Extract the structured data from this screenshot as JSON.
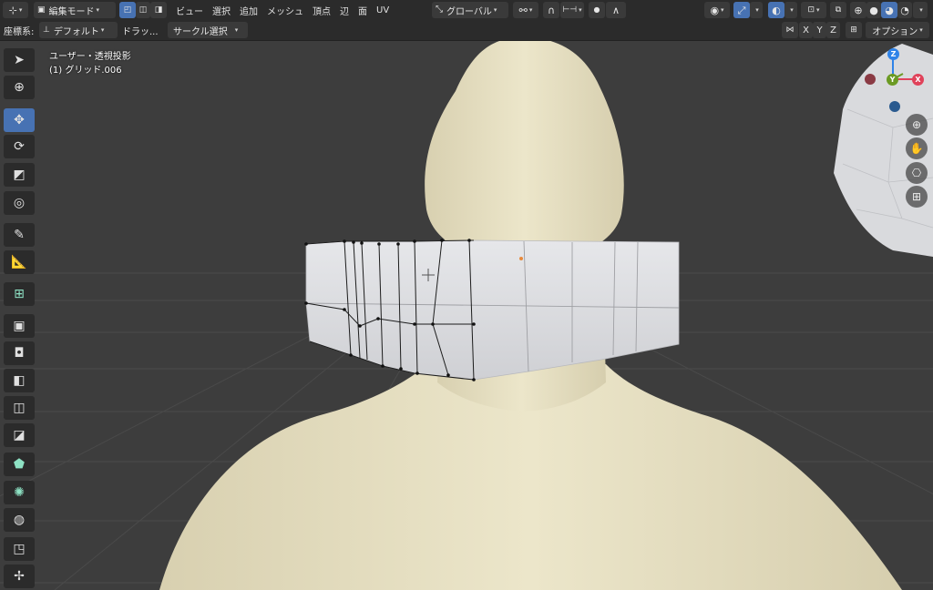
{
  "header": {
    "editor_type_icon": "editor-type-icon",
    "mode": "編集モード",
    "menus": [
      "ビュー",
      "選択",
      "追加",
      "メッシュ",
      "頂点",
      "辺",
      "面",
      "UV"
    ],
    "transform_orientation": "グローバル",
    "options_label": "オプション"
  },
  "toolbar2": {
    "coord_label": "座標系:",
    "coord_value": "デフォルト",
    "drag_label": "ドラッ...",
    "select_mode": "サークル選択",
    "axes": [
      "X",
      "Y",
      "Z"
    ]
  },
  "viewport": {
    "view_name": "ユーザー・透視投影",
    "object_name": "(1) グリッド.006"
  },
  "gizmo": {
    "z": "Z",
    "y": "Y",
    "x": "X"
  },
  "tools": [
    "select-cursor-icon",
    "cursor-icon",
    "move-icon",
    "rotate-icon",
    "scale-icon",
    "transform-icon",
    "annotate-icon",
    "measure-icon",
    "add-cube-icon",
    "extrude-icon",
    "inset-icon",
    "bevel-icon",
    "loop-cut-icon",
    "knife-icon",
    "poly-build-icon",
    "spin-icon",
    "smooth-icon",
    "edge-slide-icon",
    "shrink-icon"
  ],
  "colors": {
    "header_bg": "#2b2b2b",
    "viewport_bg": "#3d3d3d",
    "accent": "#4772b3",
    "body_color": "#e8e2c6",
    "mesh_color": "#dcdde0",
    "axis_x": "#e0425a",
    "axis_y": "#6b9a23",
    "axis_z": "#2f83e8"
  }
}
